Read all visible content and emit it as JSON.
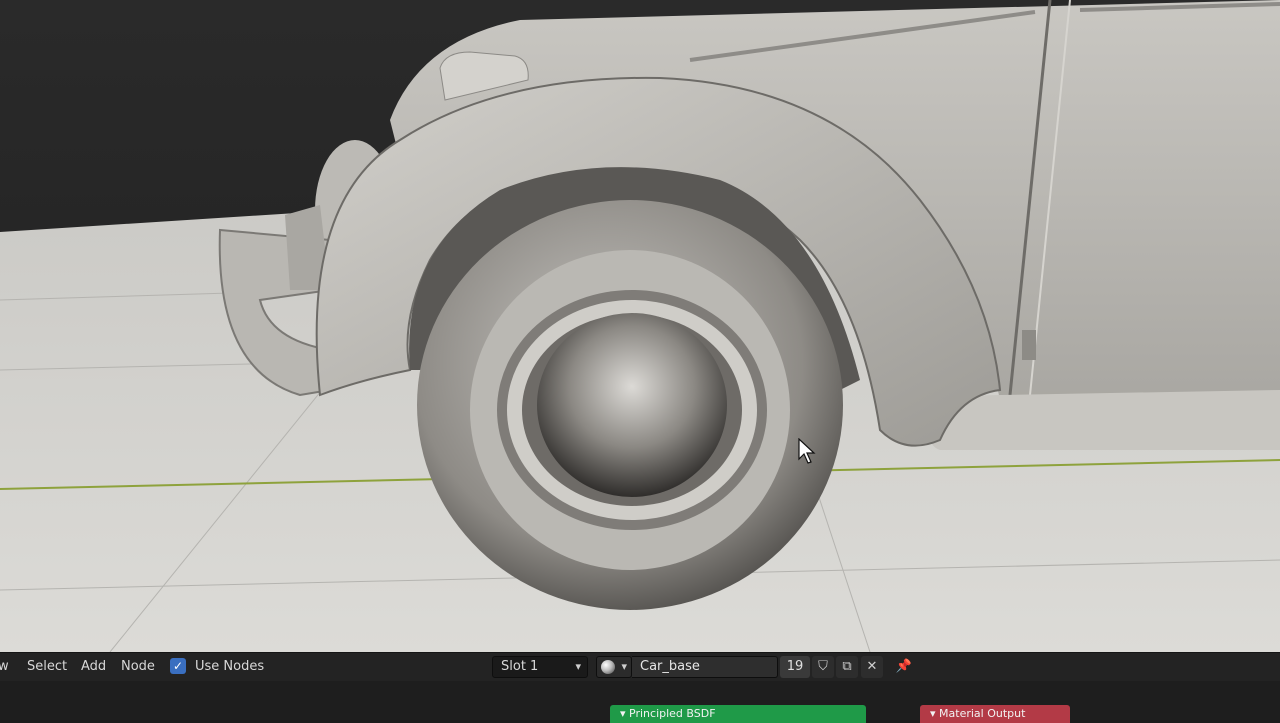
{
  "header": {
    "menu": [
      "w",
      "Select",
      "Add",
      "Node"
    ],
    "use_nodes_label": "Use Nodes",
    "use_nodes_checked": true,
    "slot_label": "Slot 1",
    "material_name": "Car_base",
    "users_count": "19"
  },
  "nodes": {
    "principled_label": "Principled BSDF",
    "output_label": "Material Output",
    "principled_color": "#1f9a48",
    "output_color": "#b33a46"
  },
  "icons": {
    "dropdown": "chevron-down-icon",
    "material_preview": "sphere-icon",
    "fake_user": "shield-icon",
    "duplicate": "duplicate-icon",
    "unlink": "close-icon",
    "pin": "pin-icon"
  }
}
